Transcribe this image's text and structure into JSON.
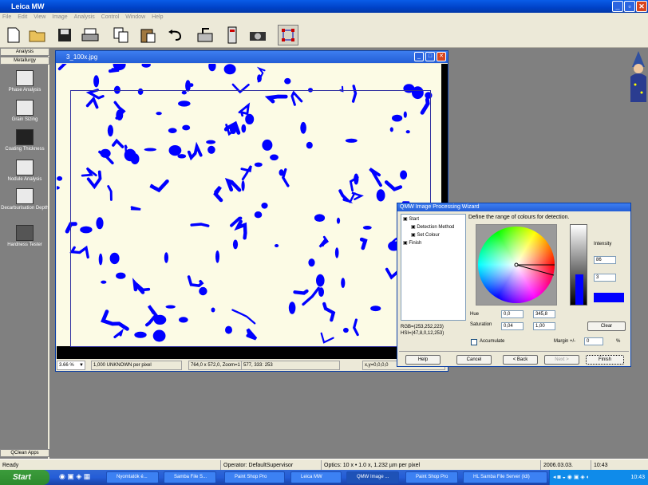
{
  "app": {
    "title": "Leica MW"
  },
  "menu": [
    "File",
    "Edit",
    "View",
    "Image",
    "Analysis",
    "Control",
    "Window",
    "Help"
  ],
  "toolbar": {
    "icons": [
      "new-icon",
      "open-icon",
      "save-icon",
      "print-icon",
      "copy-icon",
      "paste-icon",
      "undo-icon",
      "acquire-icon",
      "calibrate-icon",
      "camera-icon",
      "select-icon"
    ]
  },
  "left_panel": {
    "tab_analysis": "Analysis",
    "tab_metallurgy": "Metallurgy",
    "items": [
      "Phase Analysis",
      "Grain Sizing",
      "Coating Thickness",
      "Nodule Analysis",
      "Decarburisation Depth",
      "Hardness Tester"
    ],
    "bottom": "QClean Apps"
  },
  "image_window": {
    "title": "3_100x.jpg",
    "zoom": "3.66 %",
    "calibration": "1,000 UNKNOWN per pixel",
    "size": "764,0 x 572,0, Zoom=1",
    "pixel": "577, 333: 253",
    "xy": "x,y=0,0,0,0"
  },
  "wizard": {
    "title": "QMW Image Processing Wizard",
    "tree": [
      "Start",
      "Detection Method",
      "Set Colour",
      "Finish"
    ],
    "instruction": "Define the range of colours for detection.",
    "intensity_label": "Intensity",
    "intensity_max": "86",
    "intensity_min": "3",
    "hue_label": "Hue",
    "hue_min": "0,0",
    "hue_max": "345,8",
    "saturation_label": "Saturation",
    "sat_min": "0,04",
    "sat_max": "1,00",
    "rgb": "RGB=(253,252,223)",
    "hsi": "HSI=(47,8,0,12,253)",
    "accumulate": "Accumulate",
    "margin_label": "Margin +/-",
    "margin_value": "0",
    "margin_unit": "%",
    "clear": "Clear",
    "help": "Help",
    "cancel": "Cancel",
    "back": "< Back",
    "next": "Next >",
    "finish": "Finish",
    "detection_color": "#0000ff"
  },
  "statusbar": {
    "ready": "Ready",
    "operator": "Operator: DefaultSupervisor",
    "optics": "Optics: 10 x • 1.0 x, 1.232 µm per pixel",
    "date": "2006.03.03.",
    "time": "10:43"
  },
  "taskbar": {
    "start": "Start",
    "tasks": [
      "Nyomtatók é...",
      "Samba File S...",
      "Paint Shop Pro",
      "Leica MW",
      "QMW Image ...",
      "Paint Shop Pro",
      "HL Samba File Server (Idl)"
    ],
    "clock": "10:43"
  }
}
